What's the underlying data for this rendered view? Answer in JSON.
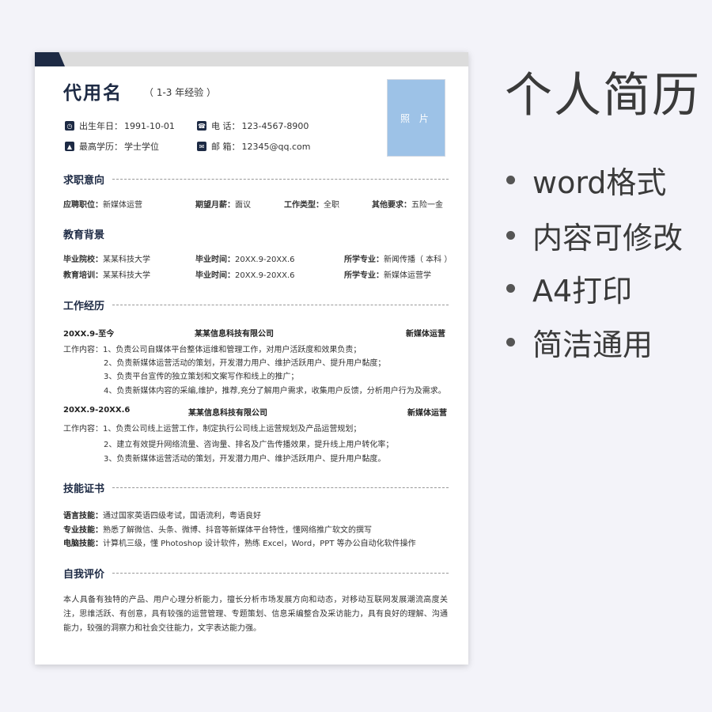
{
  "resume": {
    "name": "代用名",
    "experience": "（ 1-3 年经验 ）",
    "photo": "照 片",
    "info": [
      {
        "label": "出生年日：",
        "value": "1991-10-01",
        "icon": "calendar-icon"
      },
      {
        "label": "电 话：",
        "value": "123-4567-8900",
        "icon": "phone-icon"
      },
      {
        "label": "最高学历：",
        "value": "学士学位",
        "icon": "graduation-icon"
      },
      {
        "label": "邮 箱：",
        "value": "12345@qq.com",
        "icon": "mail-icon"
      }
    ],
    "sections": {
      "intent": "求职意向",
      "education": "教育背景",
      "work": "工作经历",
      "skills": "技能证书",
      "self": "自我评价"
    },
    "intent": [
      {
        "label": "应聘职位：",
        "value": "新媒体运营"
      },
      {
        "label": "期望月薪：",
        "value": "面议"
      },
      {
        "label": "工作类型：",
        "value": "全职"
      },
      {
        "label": "其他要求：",
        "value": "五险一金"
      }
    ],
    "education": [
      [
        {
          "label": "毕业院校：",
          "value": "某某科技大学"
        },
        {
          "label": "毕业时间：",
          "value": "20XX.9-20XX.6"
        },
        {
          "label": "所学专业：",
          "value": "新闻传播（ 本科 ）"
        }
      ],
      [
        {
          "label": "教育培训：",
          "value": "某某科技大学"
        },
        {
          "label": "毕业时间：",
          "value": "20XX.9-20XX.6"
        },
        {
          "label": "所学专业：",
          "value": "新媒体运营学"
        }
      ]
    ],
    "jobs": [
      {
        "period": "20XX.9-至今",
        "company": "某某信息科技有限公司",
        "position": "新媒体运营",
        "prefix": "工作内容：",
        "duties": [
          "1、负责公司自媒体平台整体运维和管理工作，对用户活跃度和效果负责；",
          "2、负责新媒体运营活动的策划，开发潜力用户、维护活跃用户、提升用户黏度；",
          "3、负责平台宣传的独立策划和文案写作和线上的推广；",
          "4、负责新媒体内容的采编,维护，推荐,充分了解用户需求，收集用户反馈，分析用户行为及需求。"
        ]
      },
      {
        "period": "20XX.9-20XX.6",
        "company": "某某信息科技有限公司",
        "position": "新媒体运营",
        "prefix": "工作内容：",
        "duties": [
          "1、负责公司线上运营工作，制定执行公司线上运营规划及产品运营规划；",
          "2、建立有效提升网络流量、咨询量、排名及广告传播效果，提升线上用户转化率；",
          "3、负责新媒体运营活动的策划，开发潜力用户、维护活跃用户、提升用户黏度。"
        ]
      }
    ],
    "skills": [
      {
        "label": "语言技能：",
        "value": "通过国家英语四级考试，国语流利，粤语良好"
      },
      {
        "label": "专业技能：",
        "value": "熟悉了解微信、头条、微博、抖音等新媒体平台特性，懂网络推广软文的撰写"
      },
      {
        "label": "电脑技能：",
        "value": "计算机三级，懂 Photoshop 设计软件，熟练 Excel，Word，PPT 等办公自动化软件操作"
      }
    ],
    "self_eval": "本人具备有独特的产品、用户心理分析能力，擅长分析市场发展方向和动态，对移动互联网发展潮流高度关注，思维活跃、有创意，具有较强的运营管理、专题策划、信息采编整合及采访能力，具有良好的理解、沟通能力，较强的洞察力和社会交往能力，文字表达能力强。"
  },
  "side": {
    "title": "个人简历",
    "bullets": [
      "word格式",
      "内容可修改",
      "A4打印",
      "简洁通用"
    ]
  },
  "colors": {
    "accent": "#1d2a44",
    "photo_bg": "#9dc2e7",
    "background": "#f3f3f9"
  }
}
